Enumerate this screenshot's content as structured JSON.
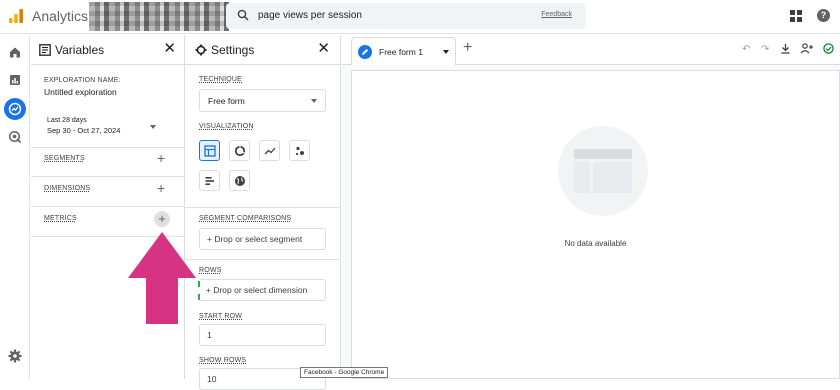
{
  "app": {
    "title": "Analytics",
    "logo_icon": "analytics-logo-icon"
  },
  "search": {
    "query": "page views per session",
    "feedback_label": "Feedback"
  },
  "variables": {
    "title": "Variables",
    "exploration_name_label": "EXPLORATION NAME:",
    "exploration_name": "Untitled exploration",
    "date_range_label": "Last 28 days",
    "date_range_value": "Sep 30 - Oct 27, 2024",
    "segments_label": "SEGMENTS",
    "dimensions_label": "DIMENSIONS",
    "metrics_label": "METRICS"
  },
  "settings": {
    "title": "Settings",
    "technique_label": "TECHNIQUE",
    "technique_value": "Free form",
    "visualization_label": "VISUALIZATION",
    "segment_comparisons_label": "SEGMENT COMPARISONS",
    "drop_segment": "Drop or select segment",
    "rows_label": "ROWS",
    "drop_dimension": "Drop or select dimension",
    "start_row_label": "START ROW",
    "start_row_value": "1",
    "show_rows_label": "SHOW ROWS",
    "show_rows_value": "10"
  },
  "canvas": {
    "tab_label": "Free form 1",
    "empty_message": "No data available"
  },
  "tooltip": {
    "text": "Facebook - Google Chrome"
  },
  "colors": {
    "accent": "#1a73e8",
    "arrow": "#d63384",
    "logo_orange": "#f9ab00",
    "logo_dark": "#e37400"
  }
}
